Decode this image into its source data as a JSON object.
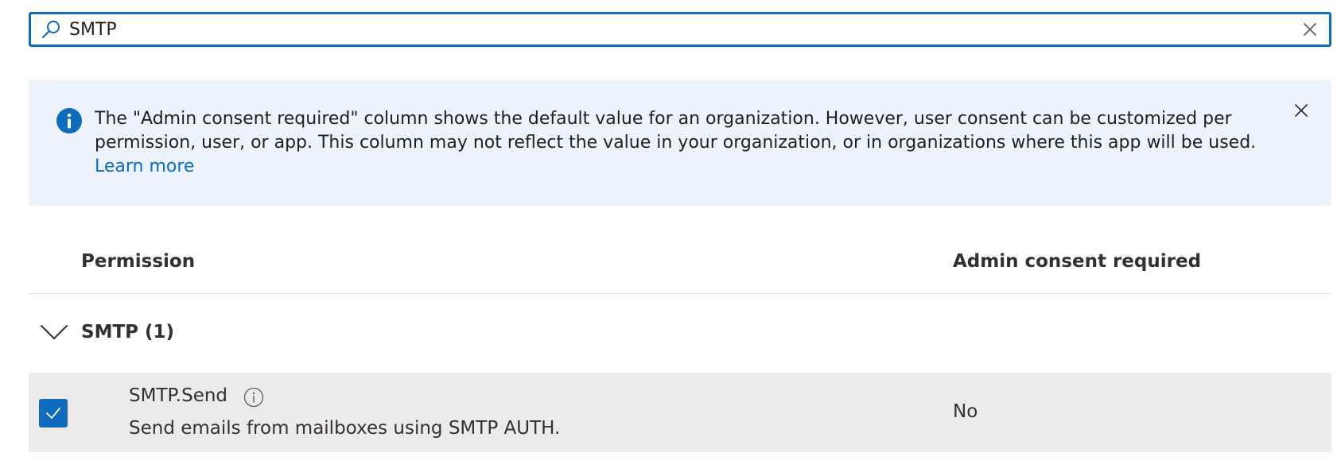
{
  "search": {
    "value": "SMTP",
    "placeholder": "",
    "icon": "search-icon",
    "clear_icon": "close-icon"
  },
  "info_banner": {
    "text": "The \"Admin consent required\" column shows the default value for an organization. However, user consent can be customized per permission, user, or app. This column may not reflect the value in your organization, or in organizations where this app will be used.",
    "link_text": "Learn more",
    "icon": "info-icon",
    "close_icon": "close-icon",
    "background_color": "#ecf3fd",
    "accent_color": "#0f6cbd"
  },
  "table": {
    "headers": {
      "permission": "Permission",
      "admin_consent": "Admin consent required"
    },
    "groups": [
      {
        "label": "SMTP (1)",
        "expanded": true,
        "items": [
          {
            "name": "SMTP.Send",
            "description": "Send emails from mailboxes using SMTP AUTH.",
            "admin_consent": "No",
            "checked": true
          }
        ]
      }
    ]
  }
}
